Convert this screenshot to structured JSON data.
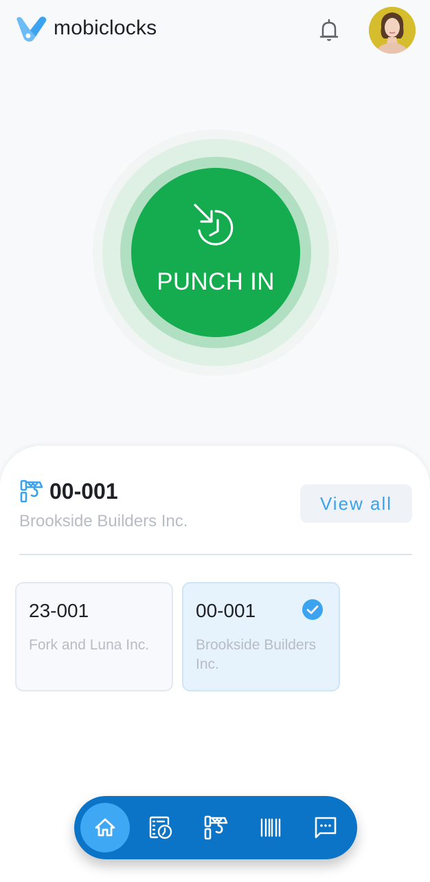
{
  "app": {
    "name": "mobiclocks",
    "logo_icon": "mobiclocks-logo-icon",
    "notifications_icon": "bell-icon",
    "avatar_icon": "user-avatar"
  },
  "punch": {
    "label": "PUNCH IN",
    "icon": "clock-in-arrow-icon",
    "color": "#15ac4f"
  },
  "current_job": {
    "icon": "crane-icon",
    "code": "00-001",
    "client": "Brookside Builders Inc.",
    "view_all_label": "View all"
  },
  "jobs": [
    {
      "code": "23-001",
      "client": "Fork and Luna Inc.",
      "selected": false
    },
    {
      "code": "00-001",
      "client": "Brookside Builders Inc.",
      "selected": true
    }
  ],
  "bottom_nav": {
    "items": [
      {
        "name": "home",
        "icon": "home-icon",
        "active": true
      },
      {
        "name": "timesheet",
        "icon": "timesheet-clock-icon",
        "active": false
      },
      {
        "name": "jobs",
        "icon": "crane-icon",
        "active": false
      },
      {
        "name": "scan",
        "icon": "barcode-icon",
        "active": false
      },
      {
        "name": "messages",
        "icon": "chat-icon",
        "active": false
      }
    ]
  },
  "colors": {
    "accent": "#39a2ee",
    "nav_bg": "#0c74c7",
    "nav_active": "#3ea8f5",
    "punch_green": "#15ac4f"
  }
}
